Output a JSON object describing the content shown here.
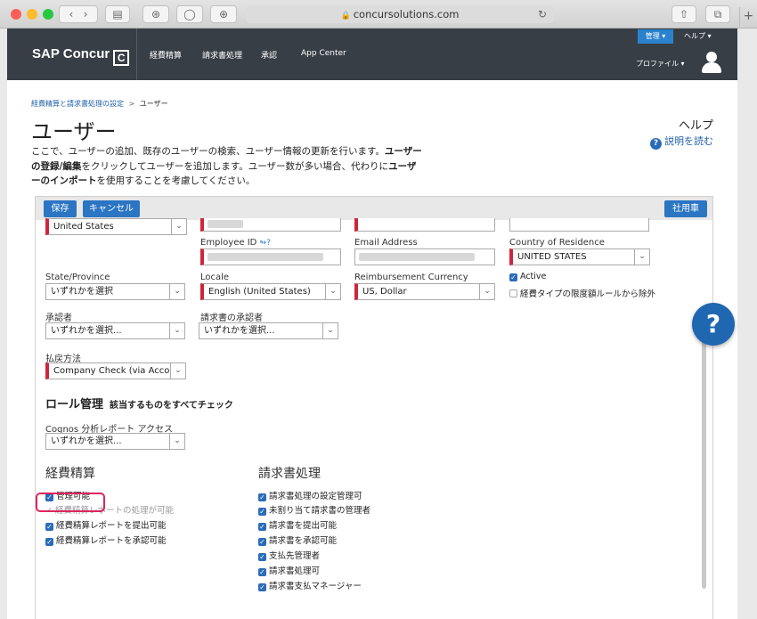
{
  "browser": {
    "url": "concursolutions.com",
    "lock_icon": "lock-icon",
    "newtab_plus": "+"
  },
  "header": {
    "logo": "SAP Concur",
    "logo_mark": "C",
    "nav": [
      "経費精算",
      "請求書処理",
      "承認",
      "App Center"
    ],
    "admin_button": "管理",
    "help": "ヘルプ",
    "profile": "プロファイル"
  },
  "breadcrumb": {
    "parent": "経費精算と請求書処理の設定",
    "separator": ">",
    "current": "ユーザー"
  },
  "page": {
    "title": "ユーザー",
    "help_label": "ヘルプ",
    "read_description": "説明を読む",
    "desc_1": "ここで、ユーザーの追加、既存のユーザーの検索、ユーザー情報の更新を行います。",
    "desc_bold_1": "ユーザーの登録/編集",
    "desc_2": "をクリックしてユーザーを追加します。ユーザー数が多い場合、代わりに",
    "desc_bold_2": "ユーザーのインポート",
    "desc_3": "を使用することを考慮してください。"
  },
  "toolbar": {
    "save": "保存",
    "cancel": "キャンセル",
    "employee": "社用車"
  },
  "form": {
    "country_value": "United States",
    "employee_id_label": "Employee ID",
    "email_label": "Email Address",
    "country_residence_label": "Country of Residence",
    "country_residence_value": "UNITED STATES",
    "state_label": "State/Province",
    "state_value": "いずれかを選択",
    "locale_label": "Locale",
    "locale_value": "English (United States)",
    "currency_label": "Reimbursement Currency",
    "currency_value": "US, Dollar",
    "active_label": "Active",
    "exclude_label": "経費タイプの限度額ルールから除外",
    "approver_label": "承認者",
    "approver_value": "いずれかを選択...",
    "invoice_approver_label": "請求書の承認者",
    "invoice_approver_value": "いずれかを選択...",
    "payment_label": "払戻方法",
    "payment_value": "Company Check (via Accour",
    "arrow": "⌄"
  },
  "roles": {
    "title": "ロール管理",
    "subtitle": "該当するものをすべてチェック",
    "cognos_label": "Cognos 分析レポート アクセス",
    "cognos_value": "いずれかを選択...",
    "expense_title": "経費精算",
    "expense_items": [
      "管理可能",
      "経費精算レポートの処理が可能",
      "経費精算レポートを提出可能",
      "経費精算レポートを承認可能"
    ],
    "invoice_title": "請求書処理",
    "invoice_items": [
      "請求書処理の設定管理可",
      "未割り当て請求書の管理者",
      "請求書を提出可能",
      "請求書を承認可能",
      "支払先管理者",
      "請求書処理可",
      "請求書支払マネージャー"
    ]
  },
  "fab": "?"
}
